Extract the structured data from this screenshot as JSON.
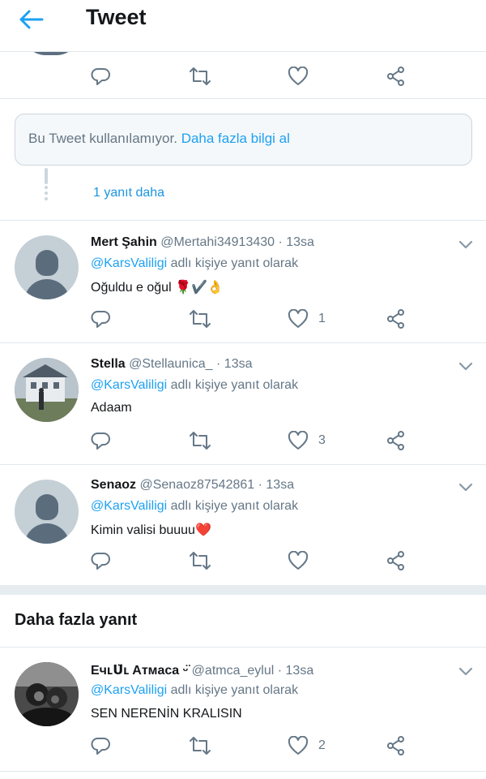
{
  "header": {
    "title": "Tweet",
    "back_icon": "arrow-left-icon",
    "accent": "#1da1f2"
  },
  "unavailable": {
    "text": "Bu Tweet kullanılamıyor.",
    "link": "Daha fazla bilgi al"
  },
  "more_replies": "1 yanıt daha",
  "section_title": "Daha fazla yanıt",
  "reply_suffix": "adlı kişiye yanıt olarak",
  "tweets": [
    {
      "name": "Mert Şahin",
      "handle": "@Mertahi34913430",
      "time": "· 13sa",
      "mention": "@KarsValiligi",
      "text": "Oğuldu e oğul 🌹✔️👌",
      "like_count": "1"
    },
    {
      "name": "Stella",
      "handle": "@Stellaunica_",
      "time": "· 13sa",
      "mention": "@KarsValiligi",
      "text": "Adaam",
      "like_count": "3"
    },
    {
      "name": "Senaoz",
      "handle": "@Senaoz87542861",
      "time": "· 13sa",
      "mention": "@KarsValiligi",
      "text": "Kimin valisi buuuu❤️",
      "like_count": ""
    },
    {
      "name": "Eчʟᑌ̈ʟ Aтмaca ᵕ̈",
      "handle": "@atmca_eylul",
      "time": "· 13sa",
      "mention": "@KarsValiligi",
      "text": "SEN NERENİN KRALISIN",
      "like_count": "2"
    }
  ]
}
